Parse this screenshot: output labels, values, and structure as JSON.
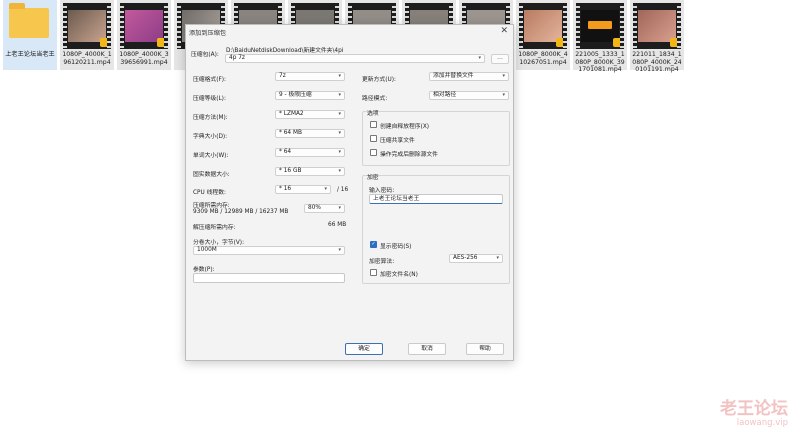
{
  "desktop_files": [
    {
      "label": "上老王论坛当老王",
      "kind": "folder"
    },
    {
      "label": "1080P_4000K_196120211.mp4",
      "kind": "video"
    },
    {
      "label": "1080P_4000K_339656991.mp4",
      "kind": "video"
    },
    {
      "label": "108",
      "kind": "video"
    },
    {
      "label": "",
      "kind": "video"
    },
    {
      "label": "",
      "kind": "video"
    },
    {
      "label": "",
      "kind": "video"
    },
    {
      "label": "",
      "kind": "video"
    },
    {
      "label": "",
      "kind": "video"
    },
    {
      "label": "1080P_8000K_410267051.mp4",
      "kind": "video"
    },
    {
      "label": "221005_1333_1080P_8000K_391701081.mp4",
      "kind": "video"
    },
    {
      "label": "221011_1834_1080P_4000K_240101191.mp4",
      "kind": "video"
    }
  ],
  "dialog": {
    "title": "添加到压缩包",
    "close": "✕",
    "archive_label": "压缩包(A):",
    "archive_path": "D:\\BaiduNetdiskDownload\\新建文件夹\\4pi",
    "archive_name": "4p 7z",
    "browse": "...",
    "left": [
      {
        "label": "压缩格式(F):",
        "value": "7z"
      },
      {
        "label": "压缩等级(L):",
        "value": "9 - 极限压缩"
      },
      {
        "label": "压缩方法(M):",
        "value": "* LZMA2"
      },
      {
        "label": "字典大小(D):",
        "value": "* 64 MB"
      },
      {
        "label": "单词大小(W):",
        "value": "* 64"
      },
      {
        "label": "固实数据大小:",
        "value": "* 16 GB"
      }
    ],
    "cpu": {
      "label": "CPU 线程数:",
      "value": "* 16",
      "total": "/ 16"
    },
    "memory_label": "压缩所需内存:",
    "memory_detail": "9309 MB / 12989 MB / 16237 MB",
    "memory_percent": "80%",
    "decomp_label": "解压缩所需内存:",
    "decomp_value": "66 MB",
    "volume_label": "分卷大小，字节(V):",
    "volume_value": "1000M",
    "params_label": "参数(P):",
    "params_value": "",
    "update_label": "更新方式(U):",
    "update_value": "添加并替换文件",
    "path_label": "路径模式:",
    "path_value": "相对路径",
    "options": {
      "title": "选项",
      "items": [
        {
          "label": "创建自释放程序(X)",
          "checked": false
        },
        {
          "label": "压缩共享文件",
          "checked": false
        },
        {
          "label": "操作完成后删除源文件",
          "checked": false
        }
      ]
    },
    "encryption": {
      "title": "加密",
      "pwd_label": "输入密码:",
      "pwd_value": "上老王论坛当老王",
      "show_pwd": "显示密码(S)",
      "show_pwd_checked": true,
      "method_label": "加密算法:",
      "method_value": "AES-256",
      "encrypt_names": "加密文件名(N)",
      "encrypt_names_checked": false
    },
    "buttons": {
      "ok": "确定",
      "cancel": "取消",
      "help": "帮助"
    }
  },
  "watermark": {
    "title": "老王论坛",
    "url": "laowang.vip"
  },
  "colors": {
    "accent": "#2f6fc2",
    "folder": "#f7c64d",
    "badge": "#f3b714"
  }
}
